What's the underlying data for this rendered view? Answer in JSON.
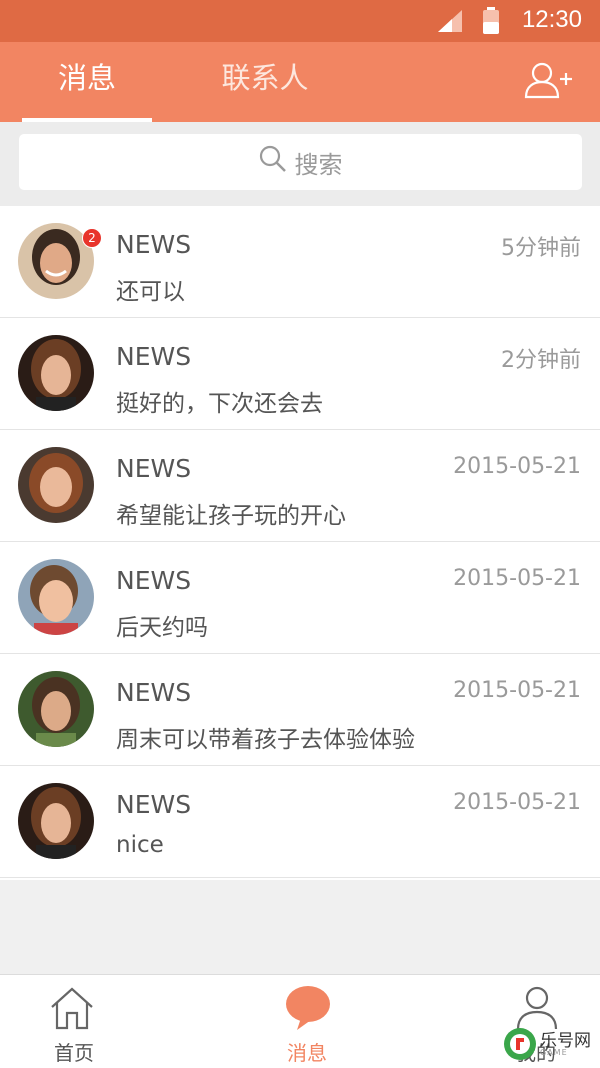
{
  "status_bar": {
    "time": "12:30"
  },
  "header": {
    "tabs": [
      {
        "label": "消息",
        "active": true
      },
      {
        "label": "联系人",
        "active": false
      }
    ],
    "add_contact_icon": "add-user-icon"
  },
  "search": {
    "placeholder": "搜索"
  },
  "messages": [
    {
      "name": "NEWS",
      "preview": "还可以",
      "time": "5分钟前",
      "unread": "2"
    },
    {
      "name": "NEWS",
      "preview": "挺好的，下次还会去",
      "time": "2分钟前"
    },
    {
      "name": "NEWS",
      "preview": "希望能让孩子玩的开心",
      "time": "2015-05-21"
    },
    {
      "name": "NEWS",
      "preview": "后天约吗",
      "time": "2015-05-21"
    },
    {
      "name": "NEWS",
      "preview": "周末可以带着孩子去体验体验",
      "time": "2015-05-21"
    },
    {
      "name": "NEWS",
      "preview": "nice",
      "time": "2015-05-21"
    }
  ],
  "bottom_nav": [
    {
      "label": "首页",
      "icon": "home-icon"
    },
    {
      "label": "消息",
      "icon": "chat-bubble-icon",
      "active": true
    },
    {
      "label": "我的",
      "icon": "person-icon"
    }
  ],
  "colors": {
    "status_bar": "#df6a44",
    "header": "#f28562",
    "accent": "#f28562",
    "badge": "#e8342b"
  },
  "watermark": {
    "text": "乐号网",
    "sub": "GAME"
  }
}
